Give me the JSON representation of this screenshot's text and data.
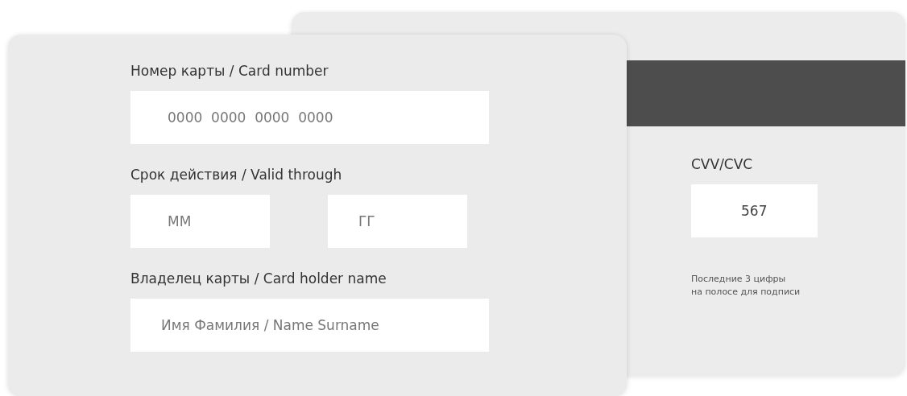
{
  "front": {
    "number_label": "Номер карты / Card number",
    "number_placeholder": "0000  0000  0000  0000",
    "expiry_label": "Срок действия / Valid through",
    "month_placeholder": "ММ",
    "year_placeholder": "ГГ",
    "holder_label": "Владелец карты / Card holder name",
    "holder_placeholder": "Имя Фамилия / Name Surname"
  },
  "back": {
    "cvv_label": "CVV/CVC",
    "cvv_value": "567",
    "hint": "Последние 3 цифры\nна полосе для подписи"
  }
}
